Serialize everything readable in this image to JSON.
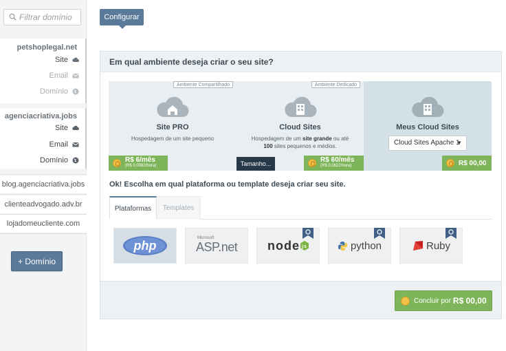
{
  "sidebar": {
    "filter_placeholder": "Filtrar domínio",
    "domains": [
      {
        "name": "petshoplegal.net",
        "site": "Site",
        "email": "Email",
        "dominio": "Domínio"
      },
      {
        "name": "agenciacriativa.jobs",
        "site": "Site",
        "email": "Email",
        "dominio": "Domínio"
      }
    ],
    "plain_domains": [
      "blog.agenciacriativa.jobs",
      "clienteadvogado.adv.br",
      "lojadomeucliente.com"
    ],
    "add_button": "+ Domínio"
  },
  "toolbar": {
    "configurar": "Configurar"
  },
  "panel": {
    "title": "Em qual ambiente deseja criar o seu site?",
    "environments": [
      {
        "tag": "Ambiente Compartilhado",
        "title": "Site PRO",
        "desc": "Hospedagem de um site pequeno",
        "price": "R$ 6/mês",
        "price_sub": "(R$ 0,0082/hora)"
      },
      {
        "tag": "Ambiente Dedicado",
        "title": "Cloud Sites",
        "desc_pre": "Hospedagem de um ",
        "desc_bold1": "site grande",
        "desc_mid": " ou até ",
        "desc_bold2": "100",
        "desc_post": " sites pequenos e médios.",
        "price": "R$ 60/mês",
        "price_sub": "(R$ 0,0822/hora)",
        "tooltip": "Tamanho..."
      },
      {
        "title": "Meus Cloud Sites",
        "select_value": "Cloud Sites Apache 1",
        "price": "R$ 00,00"
      }
    ],
    "choose_title": "Ok! Escolha em qual plataforma ou template deseja criar seu site.",
    "tabs": [
      {
        "label": "Plataformas"
      },
      {
        "label": "Templates"
      }
    ],
    "platforms": [
      {
        "label": "php"
      },
      {
        "label_small": "Microsoft",
        "label": "ASP.net"
      },
      {
        "label": "node"
      },
      {
        "label": "python"
      },
      {
        "label": "Ruby"
      }
    ],
    "conclude_prefix": "Concluir por",
    "conclude_amount": "R$ 00,00"
  },
  "colors": {
    "accent": "#5b7a99",
    "green": "#7fb55a",
    "coin": "#f3c34b"
  }
}
